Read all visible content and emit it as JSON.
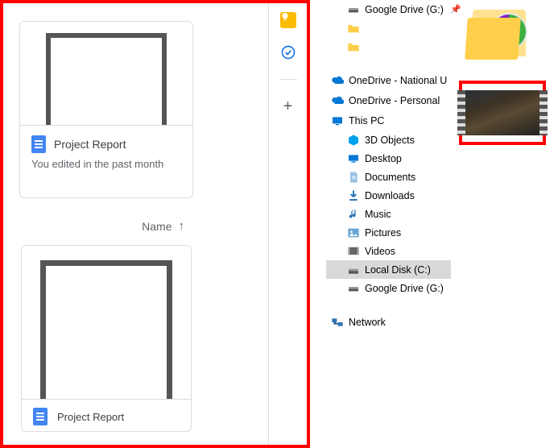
{
  "drive": {
    "suggested": {
      "title": "Project Report",
      "subtitle": "You edited in the past month"
    },
    "list": {
      "header_label": "Name",
      "sort_arrow_glyph": "↑"
    },
    "file": {
      "title": "Project Report"
    },
    "sidepanel": {
      "keep": "keep",
      "tasks": "tasks",
      "plus_glyph": "+"
    }
  },
  "explorer": {
    "tree": [
      {
        "id": "gdrive-quick",
        "label": "Google Drive (G:)",
        "icon": "drive",
        "indent": "child",
        "pinned": true
      },
      {
        "id": "qf1",
        "label": "",
        "icon": "folder",
        "indent": "child"
      },
      {
        "id": "qf2",
        "label": "",
        "icon": "folder",
        "indent": "child"
      },
      {
        "gap": true
      },
      {
        "id": "onedrive-nat",
        "label": "OneDrive - National U",
        "icon": "onedrive",
        "indent": "root",
        "expandable": true
      },
      {
        "id": "onedrive-per",
        "label": "OneDrive - Personal",
        "icon": "onedrive",
        "indent": "root",
        "expandable": true
      },
      {
        "id": "thispc",
        "label": "This PC",
        "icon": "pc",
        "indent": "root",
        "expandable": true,
        "expanded": true
      },
      {
        "id": "3dobjects",
        "label": "3D Objects",
        "icon": "3d",
        "indent": "child"
      },
      {
        "id": "desktop",
        "label": "Desktop",
        "icon": "desktop",
        "indent": "child"
      },
      {
        "id": "documents",
        "label": "Documents",
        "icon": "doc",
        "indent": "child"
      },
      {
        "id": "downloads",
        "label": "Downloads",
        "icon": "down",
        "indent": "child"
      },
      {
        "id": "music",
        "label": "Music",
        "icon": "music",
        "indent": "child"
      },
      {
        "id": "pictures",
        "label": "Pictures",
        "icon": "pic",
        "indent": "child"
      },
      {
        "id": "videos",
        "label": "Videos",
        "icon": "vid",
        "indent": "child"
      },
      {
        "id": "localdisk",
        "label": "Local Disk (C:)",
        "icon": "disk",
        "indent": "child",
        "selected": true
      },
      {
        "id": "gdrive-g",
        "label": "Google Drive (G:)",
        "icon": "drive",
        "indent": "child"
      },
      {
        "gap": true
      },
      {
        "id": "network",
        "label": "Network",
        "icon": "net",
        "indent": "root",
        "expandable": true
      }
    ]
  }
}
